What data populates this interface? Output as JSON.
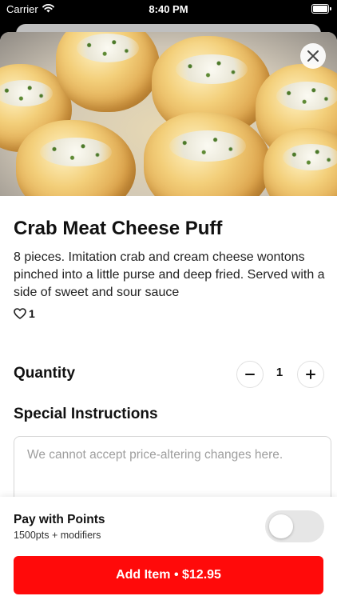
{
  "status_bar": {
    "carrier": "Carrier",
    "time": "8:40 PM"
  },
  "item": {
    "title": "Crab Meat Cheese Puff",
    "description": "8 pieces. Imitation crab and cream cheese wontons pinched into a little purse and deep fried. Served with a side of sweet and sour sauce",
    "likes": "1",
    "image_icon": "food-photo"
  },
  "quantity": {
    "label": "Quantity",
    "value": "1",
    "minus_symbol": "−",
    "plus_symbol": "+"
  },
  "instructions": {
    "label": "Special Instructions",
    "placeholder": "We cannot accept price-altering changes here."
  },
  "points": {
    "title": "Pay with Points",
    "subtitle": "1500pts + modifiers",
    "enabled": false
  },
  "add_button": {
    "label": "Add Item • $12.95"
  },
  "colors": {
    "accent": "#ff0a0a",
    "toggle_off": "#e6e6e6"
  }
}
